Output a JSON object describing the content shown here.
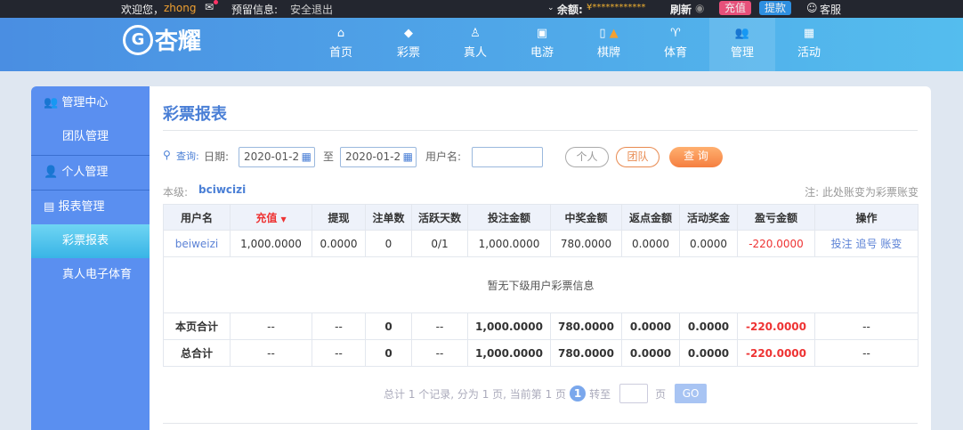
{
  "topbar": {
    "welcome": "欢迎您，",
    "username": "zhong",
    "reserve_info": "预留信息:",
    "logout": "安全退出",
    "balance_label": "余额:",
    "balance_value": "¥************",
    "refresh": "刷新",
    "recharge": "充值",
    "withdraw": "提款",
    "service": "客服"
  },
  "nav": {
    "logo": "杏耀",
    "items": [
      {
        "label": "首页",
        "icon": "home-icon"
      },
      {
        "label": "彩票",
        "icon": "ticket-icon"
      },
      {
        "label": "真人",
        "icon": "person-icon"
      },
      {
        "label": "电游",
        "icon": "slot-icon"
      },
      {
        "label": "棋牌",
        "icon": "cards-icon"
      },
      {
        "label": "体育",
        "icon": "trophy-icon"
      },
      {
        "label": "管理",
        "icon": "users-icon"
      },
      {
        "label": "活动",
        "icon": "gift-icon"
      }
    ]
  },
  "sidebar": {
    "items": [
      {
        "label": "管理中心"
      },
      {
        "label": "团队管理"
      },
      {
        "label": "个人管理"
      },
      {
        "label": "报表管理"
      },
      {
        "label": "彩票报表"
      },
      {
        "label": "真人电子体育"
      }
    ]
  },
  "main": {
    "title": "彩票报表",
    "query_label": "查询:",
    "date_label": "日期:",
    "date_from": "2020-01-2",
    "to": "至",
    "date_to": "2020-01-2",
    "username_label": "用户名:",
    "username_value": "",
    "btn_personal": "个人",
    "btn_team": "团队",
    "btn_query": "查 询",
    "level_label": "本级:",
    "level_user": "bciwcizi",
    "note": "注: 此处账变为彩票账变"
  },
  "table": {
    "headers": [
      "用户名",
      "充值",
      "提现",
      "注单数",
      "活跃天数",
      "投注金额",
      "中奖金额",
      "返点金额",
      "活动奖金",
      "盈亏金额",
      "操作"
    ],
    "row": [
      "beiweizi",
      "1,000.0000",
      "0.0000",
      "0",
      "0/1",
      "1,000.0000",
      "780.0000",
      "0.0000",
      "0.0000",
      "-220.0000"
    ],
    "actions": [
      "投注",
      "追号",
      "账变"
    ],
    "empty": "暂无下级用户彩票信息",
    "page_total": [
      "本页合计",
      "--",
      "--",
      "0",
      "--",
      "1,000.0000",
      "780.0000",
      "0.0000",
      "0.0000",
      "-220.0000",
      "--"
    ],
    "grand_total": [
      "总合计",
      "--",
      "--",
      "0",
      "--",
      "1,000.0000",
      "780.0000",
      "0.0000",
      "0.0000",
      "-220.0000",
      "--"
    ]
  },
  "pager": {
    "summary": "总计 1 个记录, 分为 1 页, 当前第 1 页",
    "current": "1",
    "goto": "转至",
    "page": "页",
    "go": "GO"
  }
}
